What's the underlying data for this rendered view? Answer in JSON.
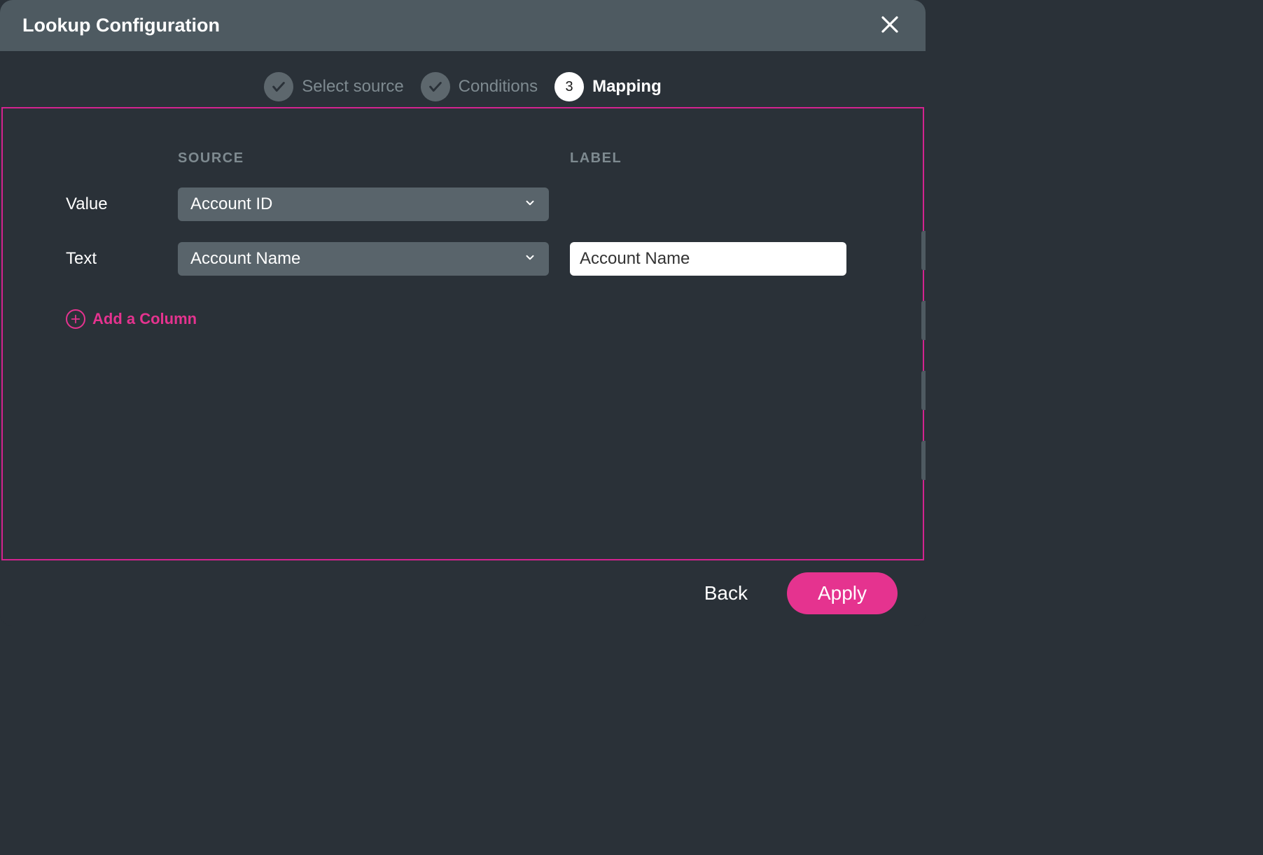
{
  "header": {
    "title": "Lookup Configuration"
  },
  "stepper": {
    "steps": [
      {
        "label": "Select source",
        "state": "completed"
      },
      {
        "label": "Conditions",
        "state": "completed"
      },
      {
        "number": "3",
        "label": "Mapping",
        "state": "active"
      }
    ]
  },
  "mapping": {
    "columns": {
      "source": "SOURCE",
      "label": "LABEL"
    },
    "rows": [
      {
        "name": "Value",
        "source_selected": "Account ID",
        "label_value": ""
      },
      {
        "name": "Text",
        "source_selected": "Account Name",
        "label_value": "Account Name"
      }
    ],
    "add_column_label": "Add a Column"
  },
  "footer": {
    "back_label": "Back",
    "apply_label": "Apply"
  },
  "colors": {
    "accent": "#e5338f",
    "border": "#d3238f"
  }
}
